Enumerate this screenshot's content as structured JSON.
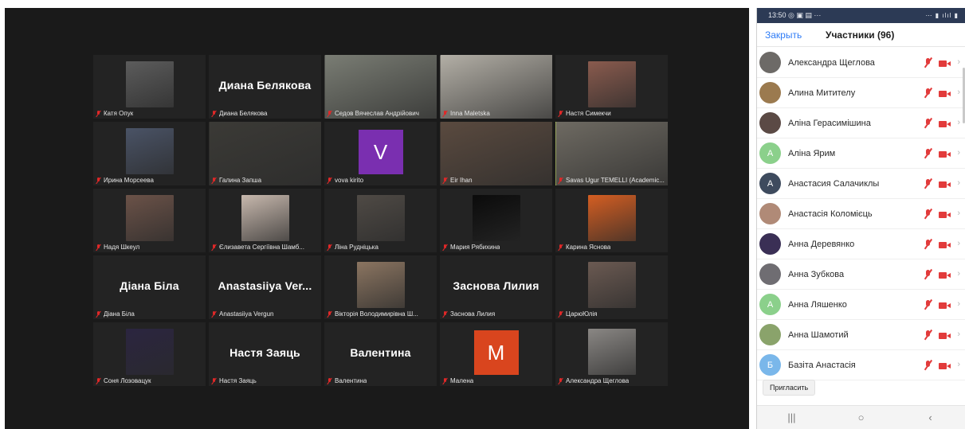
{
  "status_bar": {
    "time": "13:50",
    "left_icons": "◎ ▣ ▤  ···",
    "right_icons": "⋯ ▮ ılıl ▮"
  },
  "panel": {
    "close_label": "Закрыть",
    "title": "Участники (96)",
    "invite_label": "Пригласить"
  },
  "gallery": {
    "tiles": [
      {
        "label": "Катя Опук",
        "type": "photo",
        "color": "#5c5c5c"
      },
      {
        "label": "Диана Белякова",
        "type": "name",
        "name": "Диана Белякова"
      },
      {
        "label": "Седов Вячеслав Андрійович",
        "type": "wide",
        "color": "#7a7d74"
      },
      {
        "label": "Inna Maletska",
        "type": "wide",
        "color": "#b3afa6"
      },
      {
        "label": "Настя Симекчи",
        "type": "photo",
        "color": "#8a5b4e"
      },
      {
        "label": "Ирина Морсеева",
        "type": "photo",
        "color": "#4a5366"
      },
      {
        "label": "Галина Запша",
        "type": "wide",
        "color": "#3b3a36"
      },
      {
        "label": "vova kirito",
        "type": "letter",
        "letter": "V",
        "color": "#7a2fb0"
      },
      {
        "label": "Eir Ihan",
        "type": "wide",
        "color": "#5a4a3f"
      },
      {
        "label": "Savas Ugur TEMELLI (Academic...",
        "type": "wide",
        "color": "#6e6a62",
        "active": true
      },
      {
        "label": "Надя Шкеул",
        "type": "photo",
        "color": "#6b5248"
      },
      {
        "label": "Єлизавета Сергіївна Шамб...",
        "type": "photo",
        "color": "#c7b8ad"
      },
      {
        "label": "Ліна Рудніцька",
        "type": "photo",
        "color": "#4f4a45"
      },
      {
        "label": "Мария Рябихина",
        "type": "photo",
        "color": "#0b0b0b"
      },
      {
        "label": "Карина Яснова",
        "type": "photo",
        "color": "#d45e22"
      },
      {
        "label": "Діана Біла",
        "type": "name",
        "name": "Діана Біла"
      },
      {
        "label": "Anastasiiya Vergun",
        "type": "name",
        "name": "Anastasiiya  Ver..."
      },
      {
        "label": "Вікторія Володимирівна Ш...",
        "type": "photo",
        "color": "#8b7561"
      },
      {
        "label": "Заснова Лилия",
        "type": "name",
        "name": "Заснова Лилия"
      },
      {
        "label": "ЦарюЮлія",
        "type": "photo",
        "color": "#6b5a52"
      },
      {
        "label": "Соня Лозовацук",
        "type": "photo",
        "color": "#2b2540"
      },
      {
        "label": "Настя Заяць",
        "type": "name",
        "name": "Настя Заяць"
      },
      {
        "label": "Валентина",
        "type": "name",
        "name": "Валентина"
      },
      {
        "label": "Малена",
        "type": "letter",
        "letter": "M",
        "color": "#d9451e"
      },
      {
        "label": "Александра Щеглова",
        "type": "photo",
        "color": "#8a8784"
      }
    ]
  },
  "participants": [
    {
      "name": "Александра Щеглова",
      "avatar_color": "#6d6a67",
      "initial": ""
    },
    {
      "name": "Алина Митителу",
      "avatar_color": "#9b7a4f",
      "initial": ""
    },
    {
      "name": "Аліна Герасимішина",
      "avatar_color": "#5b4a45",
      "initial": ""
    },
    {
      "name": "Аліна Ярим",
      "avatar_color": "#8bd08b",
      "initial": "А"
    },
    {
      "name": "Анастасия Салачиклы",
      "avatar_color": "#3e4b5e",
      "initial": "А"
    },
    {
      "name": "Анастасія Коломієць",
      "avatar_color": "#b08a77",
      "initial": ""
    },
    {
      "name": "Анна Деревянко",
      "avatar_color": "#3a2f55",
      "initial": ""
    },
    {
      "name": "Анна Зубкова",
      "avatar_color": "#6f6d72",
      "initial": ""
    },
    {
      "name": "Анна Ляшенко",
      "avatar_color": "#8bd08b",
      "initial": "А"
    },
    {
      "name": "Анна Шамотий",
      "avatar_color": "#8aa36b",
      "initial": ""
    },
    {
      "name": "Базіта Анастасія",
      "avatar_color": "#7ab7ea",
      "initial": "Б"
    }
  ],
  "nav": {
    "recents": "|||",
    "home": "○",
    "back": "‹"
  }
}
